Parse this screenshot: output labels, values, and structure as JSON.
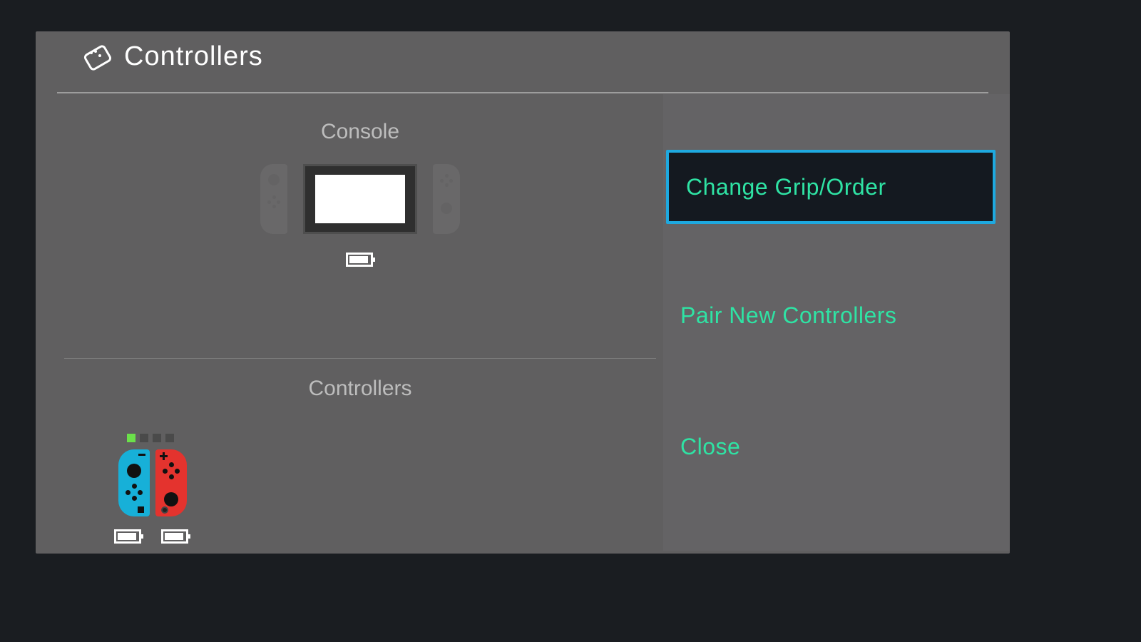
{
  "header": {
    "title": "Controllers"
  },
  "sections": {
    "console_label": "Console",
    "controllers_label": "Controllers"
  },
  "console": {
    "battery_pct": 80
  },
  "player1": {
    "active_led": 1,
    "left_color": "#17b0d8",
    "right_color": "#e4332e",
    "left_battery_pct": 80,
    "right_battery_pct": 80
  },
  "menu": {
    "items": [
      {
        "label": "Change Grip/Order",
        "selected": true
      },
      {
        "label": "Pair New Controllers",
        "selected": false
      },
      {
        "label": "Close",
        "selected": false
      }
    ]
  },
  "colors": {
    "accent": "#2fe3a4",
    "highlight_border": "#1ea9e0"
  }
}
